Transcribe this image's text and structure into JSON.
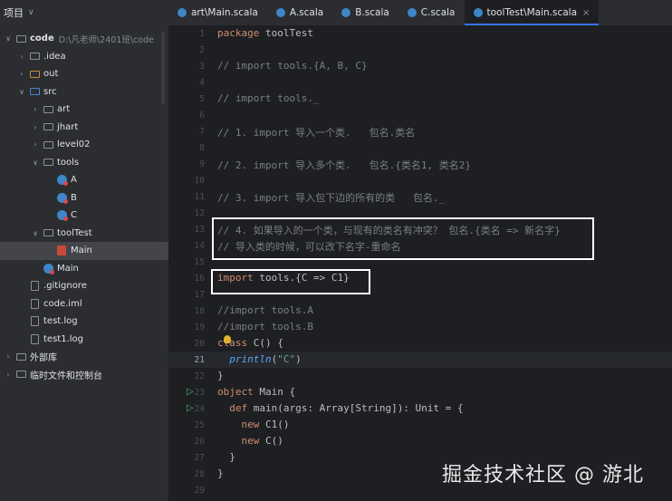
{
  "sidebar": {
    "title": "项目",
    "items": [
      {
        "label": "code",
        "path": "D:\\凡老师\\2401班\\code",
        "icon": "folder-icon",
        "indent": 0,
        "expanded": true,
        "kind": "folder",
        "bold": true
      },
      {
        "label": ".idea",
        "icon": "folder-icon",
        "indent": 1,
        "expanded": false,
        "kind": "folder"
      },
      {
        "label": "out",
        "icon": "folder-orange-icon",
        "indent": 1,
        "expanded": false,
        "kind": "folder-orange"
      },
      {
        "label": "src",
        "icon": "folder-blue-icon",
        "indent": 1,
        "expanded": true,
        "kind": "folder-blue"
      },
      {
        "label": "art",
        "icon": "package-icon",
        "indent": 2,
        "expanded": false,
        "kind": "folder"
      },
      {
        "label": "jhart",
        "icon": "package-icon",
        "indent": 2,
        "expanded": false,
        "kind": "folder"
      },
      {
        "label": "level02",
        "icon": "package-icon",
        "indent": 2,
        "expanded": false,
        "kind": "folder"
      },
      {
        "label": "tools",
        "icon": "package-icon",
        "indent": 2,
        "expanded": true,
        "kind": "folder"
      },
      {
        "label": "A",
        "icon": "scala-object-icon",
        "indent": 3,
        "kind": "obj"
      },
      {
        "label": "B",
        "icon": "scala-object-icon",
        "indent": 3,
        "kind": "obj"
      },
      {
        "label": "C",
        "icon": "scala-object-icon",
        "indent": 3,
        "kind": "obj"
      },
      {
        "label": "toolTest",
        "icon": "package-icon",
        "indent": 2,
        "expanded": true,
        "kind": "folder"
      },
      {
        "label": "Main",
        "icon": "scala-file-icon",
        "indent": 3,
        "kind": "scala",
        "selected": true
      },
      {
        "label": "Main",
        "icon": "scala-object-icon",
        "indent": 2,
        "kind": "obj"
      },
      {
        "label": ".gitignore",
        "icon": "file-icon",
        "indent": 1,
        "kind": "file"
      },
      {
        "label": "code.iml",
        "icon": "file-icon",
        "indent": 1,
        "kind": "file"
      },
      {
        "label": "test.log",
        "icon": "file-icon",
        "indent": 1,
        "kind": "file"
      },
      {
        "label": "test1.log",
        "icon": "file-icon",
        "indent": 1,
        "kind": "file"
      },
      {
        "label": "外部库",
        "icon": "library-icon",
        "indent": 0,
        "expanded": false,
        "kind": "lib"
      },
      {
        "label": "临时文件和控制台",
        "icon": "scratch-icon",
        "indent": 0,
        "expanded": false,
        "kind": "lib"
      }
    ]
  },
  "tabs": [
    {
      "label": "art\\Main.scala",
      "active": false
    },
    {
      "label": "A.scala",
      "active": false
    },
    {
      "label": "B.scala",
      "active": false
    },
    {
      "label": "C.scala",
      "active": false
    },
    {
      "label": "toolTest\\Main.scala",
      "active": true
    }
  ],
  "editor": {
    "current_line": 21,
    "lines": [
      {
        "n": 1,
        "tokens": [
          [
            "kw",
            "package"
          ],
          [
            "tp",
            " toolTest"
          ]
        ]
      },
      {
        "n": 2,
        "tokens": []
      },
      {
        "n": 3,
        "tokens": [
          [
            "cm",
            "// import tools.{A, B, C}"
          ]
        ]
      },
      {
        "n": 4,
        "tokens": []
      },
      {
        "n": 5,
        "tokens": [
          [
            "cm",
            "// import tools._"
          ]
        ]
      },
      {
        "n": 6,
        "tokens": []
      },
      {
        "n": 7,
        "tokens": [
          [
            "cm",
            "// 1. import 导入一个类.   包名.类名"
          ]
        ]
      },
      {
        "n": 8,
        "tokens": []
      },
      {
        "n": 9,
        "tokens": [
          [
            "cm",
            "// 2. import 导入多个类.   包名.{类名1, 类名2}"
          ]
        ]
      },
      {
        "n": 10,
        "tokens": []
      },
      {
        "n": 11,
        "tokens": [
          [
            "cm",
            "// 3. import 导入包下边的所有的类   包名._"
          ]
        ]
      },
      {
        "n": 12,
        "tokens": []
      },
      {
        "n": 13,
        "tokens": [
          [
            "cm",
            "// 4. 如果导入的一个类，与现有的类名有冲突？ 包名.{类名 => 新名字}"
          ]
        ]
      },
      {
        "n": 14,
        "tokens": [
          [
            "cm",
            "// 导入类的时候，可以改下名字-重命名"
          ]
        ]
      },
      {
        "n": 15,
        "tokens": []
      },
      {
        "n": 16,
        "tokens": [
          [
            "kw",
            "import"
          ],
          [
            "tp",
            " tools.{C => C1}"
          ]
        ]
      },
      {
        "n": 17,
        "tokens": []
      },
      {
        "n": 18,
        "tokens": [
          [
            "cm",
            "//import tools.A"
          ]
        ]
      },
      {
        "n": 19,
        "tokens": [
          [
            "cm",
            "//import tools.B"
          ]
        ]
      },
      {
        "n": 20,
        "tokens": [
          [
            "kw",
            "class"
          ],
          [
            "tp",
            " C() {"
          ]
        ]
      },
      {
        "n": 21,
        "tokens": [
          [
            "tp",
            "  "
          ],
          [
            "fn",
            "println"
          ],
          [
            "tp",
            "("
          ],
          [
            "str",
            "\"C\""
          ],
          [
            "tp",
            ")"
          ]
        ]
      },
      {
        "n": 22,
        "tokens": [
          [
            "tp",
            "}"
          ]
        ]
      },
      {
        "n": 23,
        "tokens": [
          [
            "kw",
            "object"
          ],
          [
            "tp",
            " Main {"
          ]
        ]
      },
      {
        "n": 24,
        "tokens": [
          [
            "tp",
            "  "
          ],
          [
            "kw",
            "def"
          ],
          [
            "tp",
            " main(args: Array[String]): Unit = {"
          ]
        ]
      },
      {
        "n": 25,
        "tokens": [
          [
            "tp",
            "    "
          ],
          [
            "kw",
            "new"
          ],
          [
            "tp",
            " C1()"
          ]
        ]
      },
      {
        "n": 26,
        "tokens": [
          [
            "tp",
            "    "
          ],
          [
            "kw",
            "new"
          ],
          [
            "tp",
            " C()"
          ]
        ]
      },
      {
        "n": 27,
        "tokens": [
          [
            "tp",
            "  }"
          ]
        ]
      },
      {
        "n": 28,
        "tokens": [
          [
            "tp",
            "}"
          ]
        ]
      },
      {
        "n": 29,
        "tokens": []
      }
    ]
  },
  "watermark": "掘金技术社区 @ 游北"
}
